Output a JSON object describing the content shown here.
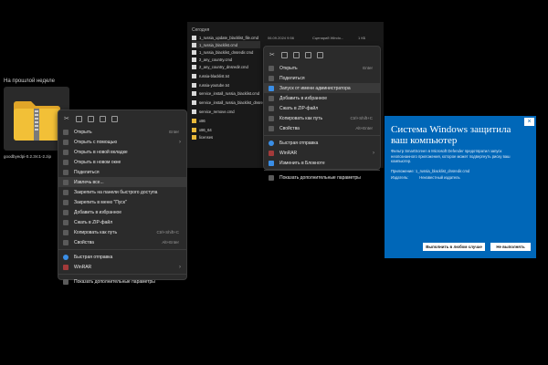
{
  "left_explorer": {
    "section_label": "На прошлой неделе",
    "zip_file_name": "goodbyedpi-0.2.3rc1-2.zip"
  },
  "left_menu": {
    "items": [
      {
        "label": "Открыть",
        "shortcut": "Enter"
      },
      {
        "label": "Открыть с помощью",
        "submenu": true
      },
      {
        "label": "Открыть в новой вкладке"
      },
      {
        "label": "Открыть в новом окне"
      },
      {
        "label": "Поделиться"
      },
      {
        "label": "Извлечь все...",
        "highlight": true
      },
      {
        "label": "Закрепить на панели быстрого доступа"
      },
      {
        "label": "Закрепить в меню \"Пуск\""
      },
      {
        "label": "Добавить в избранное"
      },
      {
        "label": "Сжать в ZIP-файл"
      },
      {
        "label": "Копировать как путь",
        "shortcut": "Ctrl+Shift+C"
      },
      {
        "label": "Свойства",
        "shortcut": "Alt+Enter"
      },
      {
        "label": "Быстрая отправка"
      },
      {
        "label": "WinRAR",
        "submenu": true
      },
      {
        "label": "Показать дополнительные параметры"
      }
    ]
  },
  "top_explorer": {
    "section_label": "Сегодня",
    "files": [
      {
        "name": "1_russia_update_blacklist_file.cmd",
        "date": "06.09.2024 9:56",
        "type": "Сценарий Windo...",
        "size": "1 КБ",
        "icon": "file"
      },
      {
        "name": "1_russia_blacklist.cmd",
        "date": "",
        "type": "",
        "size": "",
        "icon": "file"
      },
      {
        "name": "1_russia_blacklist_dnsredir.cmd",
        "date": "",
        "type": "",
        "size": "",
        "icon": "file"
      },
      {
        "name": "2_any_country.cmd",
        "date": "",
        "type": "",
        "size": "",
        "icon": "file"
      },
      {
        "name": "2_any_country_dnsredir.cmd",
        "date": "",
        "type": "",
        "size": "",
        "icon": "file"
      },
      {
        "name": "russia-blacklist.txt",
        "date": "",
        "type": "",
        "size": "",
        "icon": "file"
      },
      {
        "name": "russia-youtube.txt",
        "date": "",
        "type": "",
        "size": "",
        "icon": "file"
      },
      {
        "name": "service_install_russia_blacklist.cmd",
        "date": "",
        "type": "",
        "size": "",
        "icon": "file"
      },
      {
        "name": "service_install_russia_blacklist_dnsredir.cmd",
        "date": "",
        "type": "",
        "size": "",
        "icon": "file"
      },
      {
        "name": "service_remove.cmd",
        "date": "",
        "type": "",
        "size": "",
        "icon": "file"
      },
      {
        "name": "x86",
        "date": "",
        "type": "",
        "size": "",
        "icon": "folder"
      },
      {
        "name": "x86_64",
        "date": "",
        "type": "",
        "size": "",
        "icon": "folder"
      },
      {
        "name": "licenses",
        "date": "",
        "type": "",
        "size": "",
        "icon": "folder"
      }
    ]
  },
  "right_menu": {
    "items": [
      {
        "label": "Открыть",
        "shortcut": "Enter"
      },
      {
        "label": "Поделиться"
      },
      {
        "label": "Запуск от имени администратора",
        "highlight": true
      },
      {
        "label": "Добавить в избранное"
      },
      {
        "label": "Сжать в ZIP-файл"
      },
      {
        "label": "Копировать как путь",
        "shortcut": "Ctrl+Shift+C"
      },
      {
        "label": "Свойства",
        "shortcut": "Alt+Enter"
      },
      {
        "label": "Быстрая отправка"
      },
      {
        "label": "WinRAR",
        "submenu": true
      },
      {
        "label": "Изменить в Блокноте"
      },
      {
        "label": "Показать дополнительные параметры"
      }
    ]
  },
  "smartscreen": {
    "title": "Система Windows защитила ваш компьютер",
    "text": "Фильтр SmartScreen в Microsoft Defender предотвратил запуск неопознанного приложения, которое может подвергнуть риску ваш компьютер.",
    "app_label": "Приложение:",
    "app_value": "1_russia_blacklist_dnsredir.cmd",
    "publisher_label": "Издатель:",
    "publisher_value": "Неизвестный издатель",
    "run_anyway": "Выполнить в любом случае",
    "dont_run": "Не выполнять",
    "close_glyph": "×"
  },
  "colors": {
    "dialog_blue": "#0067b8",
    "menu_bg": "#2b2b2b",
    "zip_yellow": "#f2c037"
  }
}
